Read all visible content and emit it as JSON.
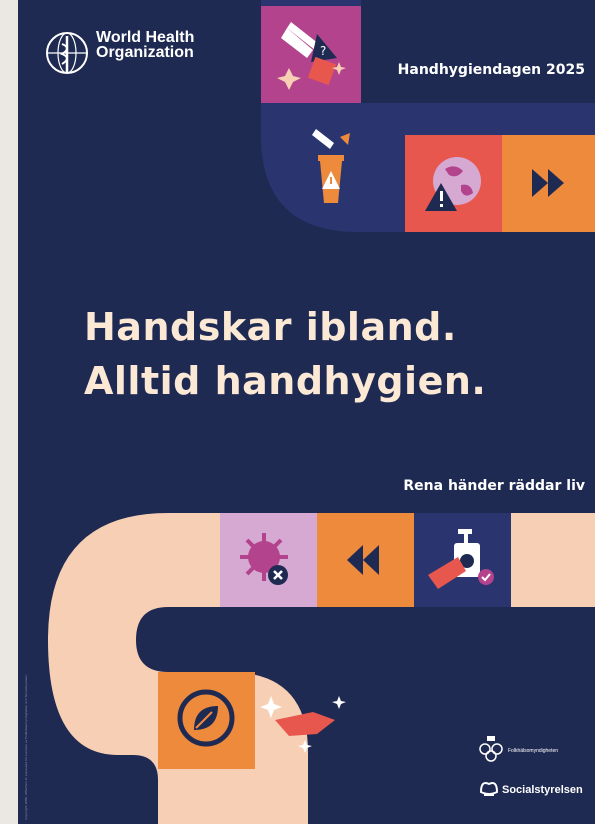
{
  "who": {
    "line1": "World Health",
    "line2": "Organization"
  },
  "campaign_title": "Handhygiendagen 2025",
  "headline": {
    "line1": "Handskar ibland.",
    "line2": "Alltid handhygien."
  },
  "tagline": "Rena händer räddar liv",
  "logos": {
    "folkhalsomyndigheten": "Folkhälsomyndigheten",
    "socialstyrelsen": "Socialstyrelsen"
  },
  "copyright": "Copyright WHO. Affischen är anpassad till svenska av Folkhälsomyndigheten och Socialstyrelsen.",
  "colors": {
    "background": "#1f2a52",
    "peach": "#f7cfb4",
    "orange": "#ee8a3c",
    "magenta": "#b2438c",
    "coral": "#e8574e",
    "lilac": "#d6a9d2",
    "navy_tile": "#2a3570"
  },
  "icons": [
    "hand-question-icon",
    "glove-trash-warning-icon",
    "globe-warning-icon",
    "fast-forward-icon",
    "germ-x-icon",
    "rewind-icon",
    "hand-sanitizer-icon",
    "leaf-icon",
    "clean-hand-sparkle-icon"
  ]
}
